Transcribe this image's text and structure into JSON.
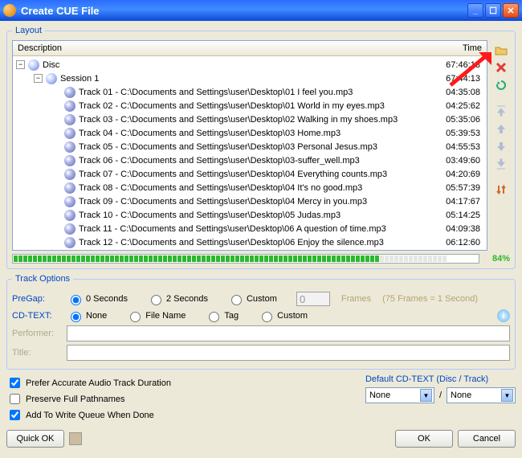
{
  "window": {
    "title": "Create CUE File"
  },
  "layout": {
    "legend": "Layout",
    "columns": {
      "description": "Description",
      "time": "Time"
    },
    "disc": {
      "label": "Disc",
      "time": "67:46:13"
    },
    "session": {
      "label": "Session 1",
      "time": "67:44:13"
    },
    "tracks": [
      {
        "label": "Track 01 - C:\\Documents and Settings\\user\\Desktop\\01 I feel you.mp3",
        "time": "04:35:08"
      },
      {
        "label": "Track 02 - C:\\Documents and Settings\\user\\Desktop\\01 World in my eyes.mp3",
        "time": "04:25:62"
      },
      {
        "label": "Track 03 - C:\\Documents and Settings\\user\\Desktop\\02 Walking in my shoes.mp3",
        "time": "05:35:06"
      },
      {
        "label": "Track 04 - C:\\Documents and Settings\\user\\Desktop\\03 Home.mp3",
        "time": "05:39:53"
      },
      {
        "label": "Track 05 - C:\\Documents and Settings\\user\\Desktop\\03 Personal Jesus.mp3",
        "time": "04:55:53"
      },
      {
        "label": "Track 06 - C:\\Documents and Settings\\user\\Desktop\\03-suffer_well.mp3",
        "time": "03:49:60"
      },
      {
        "label": "Track 07 - C:\\Documents and Settings\\user\\Desktop\\04 Everything counts.mp3",
        "time": "04:20:69"
      },
      {
        "label": "Track 08 - C:\\Documents and Settings\\user\\Desktop\\04 It's no good.mp3",
        "time": "05:57:39"
      },
      {
        "label": "Track 09 - C:\\Documents and Settings\\user\\Desktop\\04 Mercy in you.mp3",
        "time": "04:17:67"
      },
      {
        "label": "Track 10 - C:\\Documents and Settings\\user\\Desktop\\05 Judas.mp3",
        "time": "05:14:25"
      },
      {
        "label": "Track 11 - C:\\Documents and Settings\\user\\Desktop\\06 A question of time.mp3",
        "time": "04:09:38"
      },
      {
        "label": "Track 12 - C:\\Documents and Settings\\user\\Desktop\\06 Enjoy the silence.mp3",
        "time": "06:12:60"
      }
    ],
    "progress_pct": "84%"
  },
  "sidebuttons": {
    "open": "open-folder-icon",
    "delete": "delete-icon",
    "refresh": "refresh-icon",
    "top": "move-top-icon",
    "up": "move-up-icon",
    "down": "move-down-icon",
    "bottom": "move-bottom-icon",
    "sort": "sort-icon"
  },
  "track_options": {
    "legend": "Track Options",
    "pregap_label": "PreGap:",
    "pregap_opts": {
      "zero": "0 Seconds",
      "two": "2 Seconds",
      "custom": "Custom"
    },
    "pregap_frames_value": "0",
    "frames_label": "Frames",
    "frames_hint": "(75 Frames = 1 Second)",
    "cdtext_label": "CD-TEXT:",
    "cdtext_opts": {
      "none": "None",
      "filename": "File Name",
      "tag": "Tag",
      "custom": "Custom"
    },
    "performer_label": "Performer:",
    "title_label": "Title:"
  },
  "checks": {
    "accurate": "Prefer Accurate Audio Track Duration",
    "preserve": "Preserve Full Pathnames",
    "queue": "Add To Write Queue When Done"
  },
  "default_cd": {
    "legend": "Default CD-TEXT (Disc / Track)",
    "disc": "None",
    "sep": "/",
    "track": "None"
  },
  "buttons": {
    "quick_ok": "Quick OK",
    "ok": "OK",
    "cancel": "Cancel"
  }
}
